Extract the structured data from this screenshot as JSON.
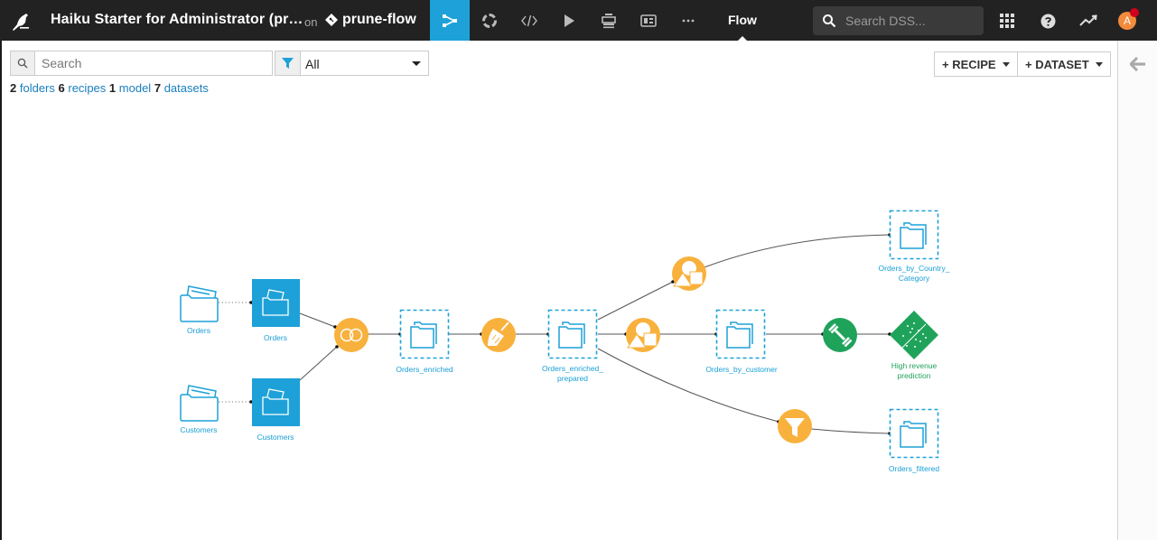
{
  "topbar": {
    "project_title": "Haiku Starter for Administrator (pr…",
    "on_label": "on",
    "branch_name": "prune-flow",
    "nav_items": [
      {
        "icon": "flow-icon",
        "active": true
      },
      {
        "icon": "lab-icon",
        "active": false
      },
      {
        "icon": "code-icon",
        "active": false
      },
      {
        "icon": "jobs-play-icon",
        "active": false
      },
      {
        "icon": "dashboard-icon",
        "active": false
      },
      {
        "icon": "wiki-icon",
        "active": false
      },
      {
        "icon": "more-icon",
        "active": false
      }
    ],
    "current_section": "Flow",
    "search_placeholder": "Search DSS...",
    "right_icons": [
      "apps-grid-icon",
      "help-icon",
      "activity-icon"
    ],
    "avatar_initial": "A",
    "notification": true,
    "colors": {
      "bg": "#222222",
      "active": "#1da1d8",
      "avatar": "#f28b3b",
      "notif": "#d0021b"
    }
  },
  "toolbar": {
    "search_placeholder": "Search",
    "filter_value": "All",
    "recipe_button": "+ RECIPE",
    "dataset_button": "+ DATASET"
  },
  "counts": {
    "folders_num": "2",
    "folders_label": "folders",
    "recipes_num": "6",
    "recipes_label": "recipes",
    "model_num": "1",
    "model_label": "model",
    "datasets_num": "7",
    "datasets_label": "datasets"
  },
  "flow": {
    "colors": {
      "dataset": "#1da1d8",
      "recipe": "#f8b13c",
      "ml": "#1fa35b",
      "edge": "#555555"
    },
    "nodes": {
      "orders_src": {
        "type": "uploaded-dataset",
        "label": "Orders"
      },
      "customers_src": {
        "type": "uploaded-dataset",
        "label": "Customers"
      },
      "orders": {
        "type": "dataset",
        "label": "Orders"
      },
      "customers": {
        "type": "dataset",
        "label": "Customers"
      },
      "join": {
        "type": "recipe-join",
        "label": ""
      },
      "orders_enriched": {
        "type": "dataset-virtual",
        "label": "Orders_enriched"
      },
      "prepare": {
        "type": "recipe-prepare",
        "label": ""
      },
      "orders_enriched_prepared": {
        "type": "dataset-virtual",
        "label_line1": "Orders_enriched_",
        "label_line2": "prepared"
      },
      "group1": {
        "type": "recipe-group",
        "label": ""
      },
      "group2": {
        "type": "recipe-group",
        "label": ""
      },
      "filter": {
        "type": "recipe-filter",
        "label": ""
      },
      "orders_by_country": {
        "type": "dataset-virtual",
        "label_line1": "Orders_by_Country_",
        "label_line2": "Category"
      },
      "orders_by_customer": {
        "type": "dataset-virtual",
        "label": "Orders_by_customer"
      },
      "orders_filtered": {
        "type": "dataset-virtual",
        "label": "Orders_filtered"
      },
      "train": {
        "type": "recipe-train",
        "label": ""
      },
      "model": {
        "type": "saved-model",
        "label_line1": "High revenue",
        "label_line2": "prediction"
      }
    }
  }
}
